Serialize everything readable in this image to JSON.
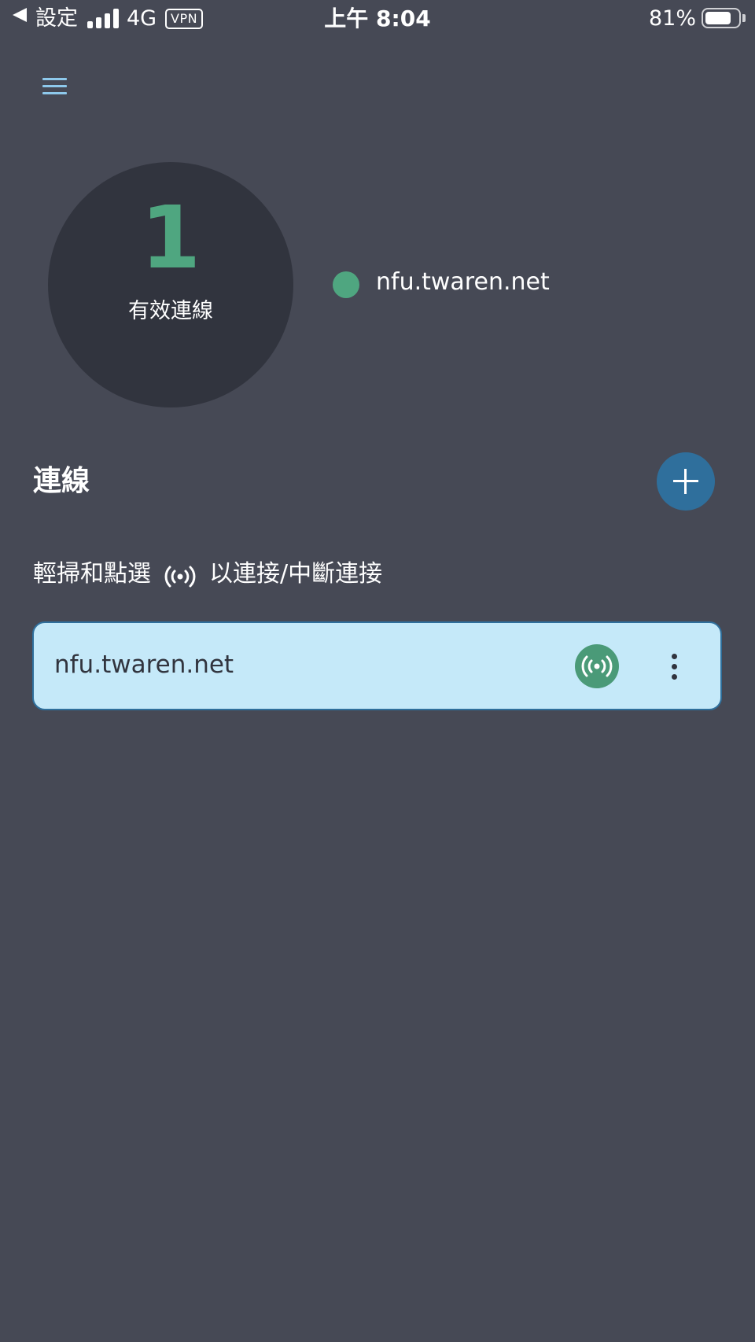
{
  "status_bar": {
    "back_label": "設定",
    "network": "4G",
    "vpn": "VPN",
    "time": "上午 8:04",
    "battery_percent": "81%",
    "battery_level": 0.81
  },
  "summary": {
    "active_count": "1",
    "active_label": "有效連線",
    "active_host": "nfu.twaren.net",
    "status_color": "#4fa680"
  },
  "section": {
    "title": "連線",
    "hint_before": "輕掃和點選",
    "hint_after": "以連接/中斷連接"
  },
  "connections": [
    {
      "name": "nfu.twaren.net",
      "connected": true
    }
  ],
  "colors": {
    "background": "#464955",
    "accent_blue": "#2f6f9c",
    "accent_green": "#4fa680",
    "card": "#c5e9f9"
  }
}
